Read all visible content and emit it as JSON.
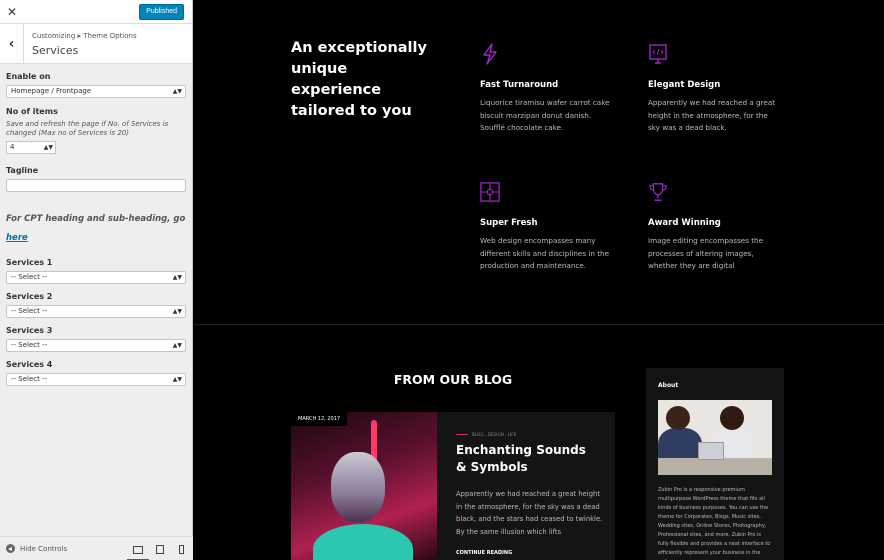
{
  "customizer": {
    "close_symbol": "✕",
    "publish_label": "Published",
    "back_symbol": "‹",
    "breadcrumb": "Customizing ▸ Theme Options",
    "section_title": "Services",
    "controls": {
      "enable_on": {
        "label": "Enable on",
        "value": "Homepage / Frontpage"
      },
      "no_items": {
        "label": "No of items",
        "description": "Save and refresh the page if No. of Services is changed (Max no of Services is 20)",
        "value": "4"
      },
      "tagline": {
        "label": "Tagline",
        "value": ""
      },
      "cpt_note": {
        "text": "For CPT heading and sub-heading, go ",
        "link": "here"
      },
      "services": [
        {
          "label": "Services 1",
          "value": "-- Select --"
        },
        {
          "label": "Services 2",
          "value": "-- Select --"
        },
        {
          "label": "Services 3",
          "value": "-- Select --"
        },
        {
          "label": "Services 4",
          "value": "-- Select --"
        }
      ]
    },
    "footer": {
      "hide_controls_label": "Hide Controls"
    }
  },
  "preview": {
    "hero_heading": "An exceptionally unique experience tailored to you",
    "services": [
      {
        "icon": "lightning-icon",
        "title": "Fast Turnaround",
        "description": "Liquorice tiramisu wafer carrot cake biscuit marzipan donut danish. Soufflé chocolate cake."
      },
      {
        "icon": "monitor-code-icon",
        "title": "Elegant Design",
        "description": "Apparently we had reached a great height in the atmosphere, for the sky was a dead black."
      },
      {
        "icon": "puzzle-icon",
        "title": "Super Fresh",
        "description": "Web design encompasses many different skills and disciplines in the production and maintenance."
      },
      {
        "icon": "trophy-icon",
        "title": "Award Winning",
        "description": "Image editing encompasses the processes of altering images, whether they are digital"
      }
    ],
    "blog": {
      "heading": "FROM OUR BLOG",
      "post": {
        "date": "MARCH 12, 2017",
        "categories": "BLOG , DESIGN , LIFE",
        "title": "Enchanting Sounds & Symbols",
        "excerpt": "Apparently we had reached a great height in the atmosphere, for the sky was a dead black, and the stars had ceased to twinkle. By the same illusion which lifts",
        "read_more": "CONTINUE READING"
      }
    },
    "about": {
      "title": "About",
      "text": "Zubin Pro is a responsive premium multipurpose WordPress theme that fits all kinds of business purposes. You can use the theme for Corporates, Blogs, Music sites, Wedding sites, Online Stores, Photography, Professional sites, and more. Zubin Pro is fully flexible and provides a neat interface to efficiently represent your business in the web"
    }
  },
  "colors": {
    "accent_purple": "#9b27c4",
    "publish_blue": "#0085ba",
    "link_blue": "#0073aa",
    "category_pink": "#d92b66"
  }
}
